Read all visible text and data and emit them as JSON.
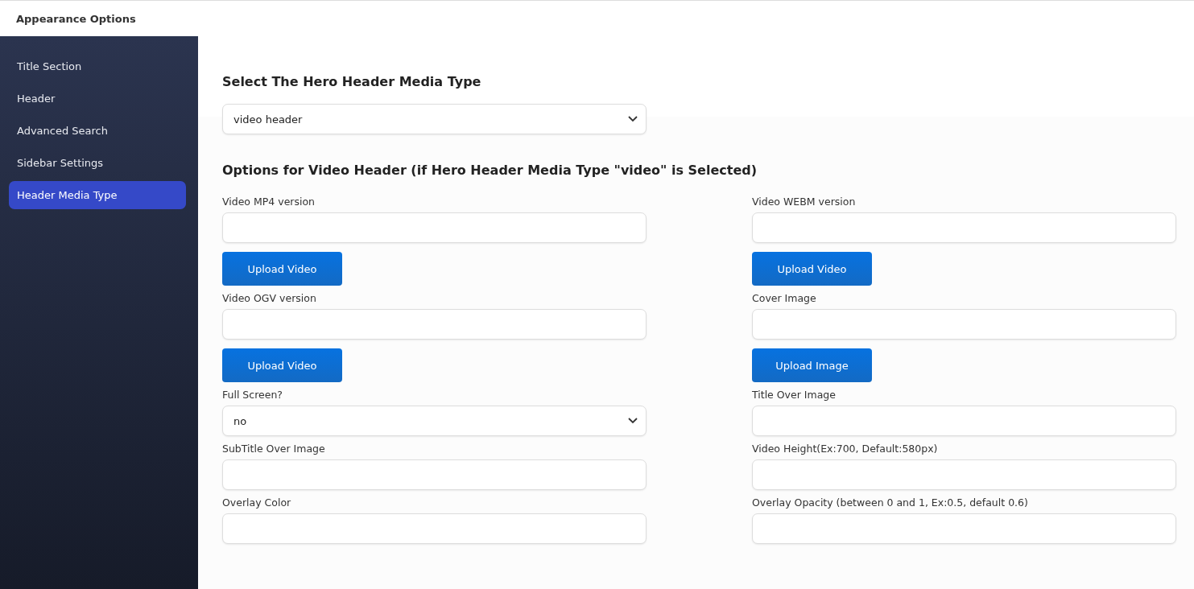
{
  "top_bar": {
    "title": "Appearance Options"
  },
  "sidebar": {
    "items": [
      {
        "label": "Title Section",
        "selected": false
      },
      {
        "label": "Header",
        "selected": false
      },
      {
        "label": "Advanced Search",
        "selected": false
      },
      {
        "label": "Sidebar Settings",
        "selected": false
      },
      {
        "label": "Header Media Type",
        "selected": true
      }
    ]
  },
  "media_type": {
    "heading": "Select The Hero Header Media Type",
    "value": "video header"
  },
  "video_options": {
    "heading": "Options for Video Header (if Hero Header Media Type \"video\" is Selected)",
    "fields": [
      {
        "kind": "text",
        "label": "Video MP4 version",
        "button": "Upload Video"
      },
      {
        "kind": "text",
        "label": "Video WEBM version",
        "button": "Upload Video"
      },
      {
        "kind": "text",
        "label": "Video OGV version",
        "button": "Upload Video"
      },
      {
        "kind": "text",
        "label": "Cover Image",
        "button": "Upload Image"
      },
      {
        "kind": "select",
        "label": "Full Screen?",
        "value": "no"
      },
      {
        "kind": "text",
        "label": "Title Over Image"
      },
      {
        "kind": "text",
        "label": "SubTitle Over Image"
      },
      {
        "kind": "text",
        "label": "Video Height(Ex:700, Default:580px)"
      },
      {
        "kind": "text",
        "label": "Overlay Color"
      },
      {
        "kind": "text",
        "label": "Overlay Opacity (between 0 and 1, Ex:0.5, default 0.6)"
      }
    ]
  }
}
